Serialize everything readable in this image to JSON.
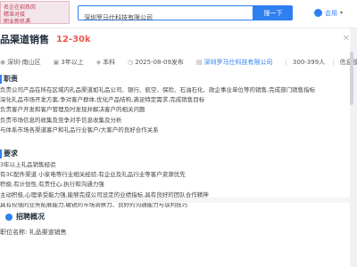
{
  "topbar": {
    "promo_text": "名企在招热岗\n精准对接\n职业新机遇",
    "search_value": "深圳罗马仕科技有限公司",
    "search_button": "搜一下",
    "user_label": "会用",
    "user_dropdown": "▾"
  },
  "job": {
    "title": "品渠道销售",
    "salary": "12-30k",
    "close": "✕"
  },
  "info": {
    "location": "深圳-南山区",
    "experience": "3年以上",
    "education": "本科",
    "date": "2025-08-09发布",
    "company": "深圳罗马仕科技有限公司",
    "size": "300-399人",
    "industry": "信息技术"
  },
  "duties": {
    "title": "职责",
    "lines": [
      "负责公司产品在所在区域内礼品渠道如礼品公司、银行、航空、保险、石油石化、政企事业单位等的销售,完成部门销售指标",
      "深化礼品市场开发方案,争对客户群体,优化产品结构,满足特定需求,完成销售目标",
      "负责客户开发和客户管理及时发现并解决客户的相关问题",
      "负责市场信息的收集及竞争对手信息收集及分析",
      "与体系市场各渠道客户和礼品行业客户/大客户的良好合作关系"
    ]
  },
  "requirements": {
    "title": "要求",
    "lines": [
      "3年以上礼品销售经验",
      "有3C配件渠道 小家电等行业相关经验,有企业及礼品行业等客户资源优先",
      "积极,有计划性,有责任心,执行和沟通力强",
      "主动积极,心理承受能力强,能够完成公司设定的业绩指标,具有良好的团队合作精神",
      "具有较强的业务拓展能力,敏锐的市场洞察力、良好的沟通能力与谈判技巧"
    ]
  },
  "overview": {
    "title": "招聘概况",
    "line": "职位名称: 礼品渠道销售"
  }
}
